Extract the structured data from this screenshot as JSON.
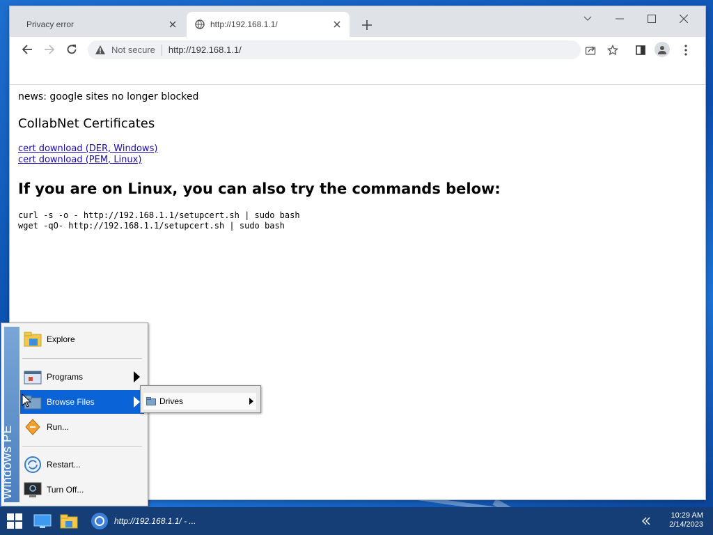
{
  "browser": {
    "tabs": [
      {
        "title": "Privacy error",
        "active": false
      },
      {
        "title": "http://192.168.1.1/",
        "active": true
      }
    ],
    "address_bar": {
      "security_label": "Not secure",
      "url": "http://192.168.1.1/"
    },
    "icons": [
      "back-icon",
      "forward-icon",
      "reload-icon",
      "share-icon",
      "bookmark-star-icon",
      "side-panel-icon",
      "profile-icon",
      "menu-kebab-icon",
      "tab-search-icon",
      "minimize-icon",
      "maximize-icon",
      "close-icon"
    ]
  },
  "page": {
    "news": "news: google sites no longer blocked",
    "heading1": "CollabNet Certificates",
    "links": [
      "cert download (DER, Windows)",
      "cert download (PEM, Linux)"
    ],
    "heading2": "If you are on Linux, you can also try the commands below:",
    "commands": [
      "curl -s -o - http://192.168.1.1/setupcert.sh | sudo bash",
      "wget -qO- http://192.168.1.1/setupcert.sh | sudo bash"
    ]
  },
  "start_menu": {
    "banner": "Windows PE",
    "items": [
      {
        "label": "Explore",
        "icon": "folder-explore-icon"
      },
      {
        "label": "Programs",
        "icon": "programs-icon",
        "submenu": true
      },
      {
        "label": "Browse Files",
        "icon": "folder-icon",
        "submenu": true,
        "selected": true
      },
      {
        "label": "Run...",
        "icon": "run-icon"
      },
      {
        "label": "Restart...",
        "icon": "restart-icon"
      },
      {
        "label": "Turn Off...",
        "icon": "turn-off-icon"
      }
    ],
    "submenu": {
      "items": [
        {
          "label": "Drives",
          "icon": "drive-folder-icon",
          "submenu": true
        }
      ]
    }
  },
  "taskbar": {
    "task_label": "http://192.168.1.1/ - ...",
    "time": "10:29 AM",
    "date": "2/14/2023"
  },
  "colors": {
    "accent": "#0a64d8",
    "taskbar": "#153e76",
    "link": "#1a0dab"
  }
}
